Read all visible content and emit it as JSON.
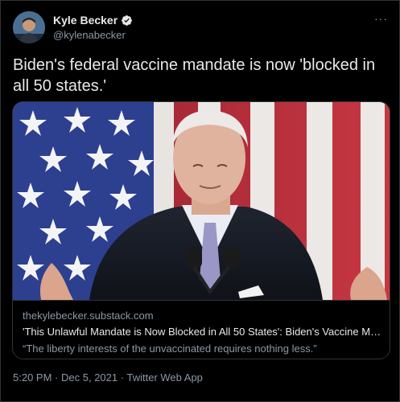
{
  "author": {
    "display_name": "Kyle Becker",
    "handle": "@kylenabecker",
    "verified": true
  },
  "tweet": {
    "text": "Biden's federal vaccine mandate is now 'blocked in all 50 states.'"
  },
  "card": {
    "domain": "thekylebecker.substack.com",
    "title": "'This Unlawful Mandate is Now Blocked in All 50 States': Biden's Vaccine Man...",
    "description": "“The liberty interests of the unvaccinated requires nothing less.”"
  },
  "footer": {
    "time": "5:20 PM",
    "sep1": "·",
    "date": "Dec 5, 2021",
    "sep2": "·",
    "source": "Twitter Web App"
  },
  "icons": {
    "more": "more-icon",
    "verified": "verified-badge-icon"
  },
  "colors": {
    "background": "#000000",
    "text_primary": "#e7e9ea",
    "text_secondary": "#8b98a5",
    "border": "#2f3336",
    "verified_badge": "#e7e9ea"
  }
}
